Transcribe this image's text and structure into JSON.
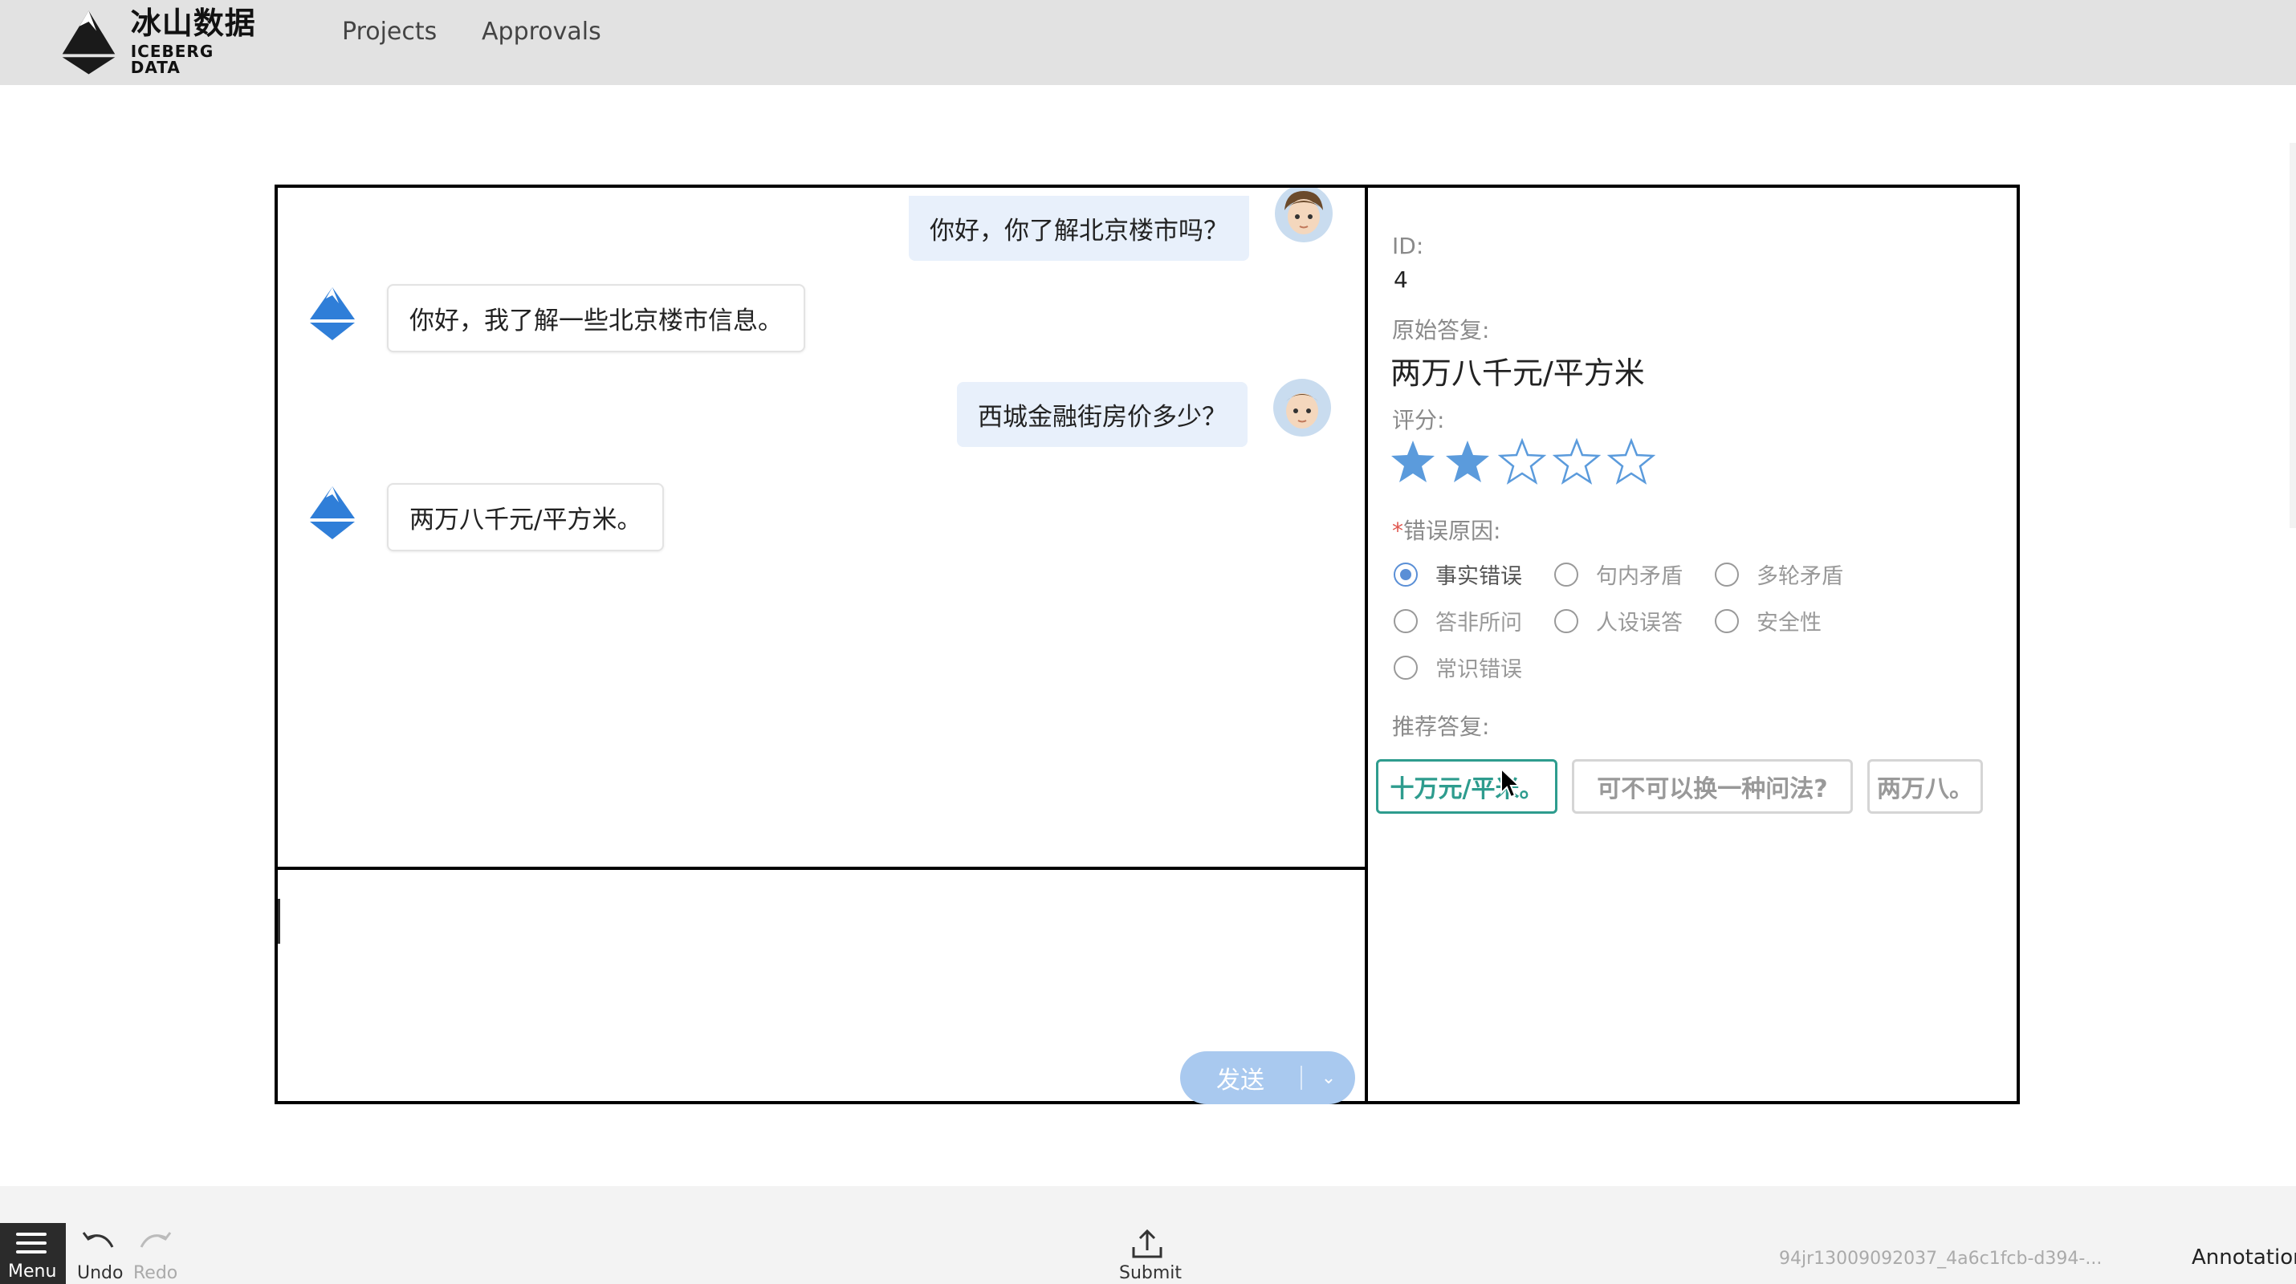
{
  "brand": {
    "name_cn": "冰山数据",
    "name_en": "ICEBERG DATA"
  },
  "nav": {
    "projects": "Projects",
    "approvals": "Approvals"
  },
  "chat": {
    "messages": [
      {
        "role": "user",
        "text": "你好，你了解北京楼市吗？"
      },
      {
        "role": "bot",
        "text": "你好，我了解一些北京楼市信息。"
      },
      {
        "role": "user",
        "text": "西城金融街房价多少？"
      },
      {
        "role": "bot",
        "text": "两万八千元/平方米。"
      }
    ],
    "send_label": "发送",
    "send_arrow": "⌄"
  },
  "side": {
    "id_label": "ID:",
    "id_value": "4",
    "original_label": "原始答复:",
    "original_value": "两万八千元/平方米",
    "rating_label": "评分:",
    "rating": 2,
    "rating_max": 5,
    "error_required": "*",
    "error_label": "错误原因:",
    "error_options": [
      "事实错误",
      "句内矛盾",
      "多轮矛盾",
      "答非所问",
      "人设误答",
      "安全性",
      "常识错误"
    ],
    "error_selected": "事实错误",
    "suggest_label": "推荐答复:",
    "suggestions": [
      "十万元/平米。",
      "可不可以换一种问法?",
      "两万八。"
    ]
  },
  "toolbar": {
    "menu": "Menu",
    "undo": "Undo",
    "redo": "Redo",
    "submit": "Submit",
    "hash": "94jr13009092037_4a6c1fcb-d394-...",
    "annotation": "Annotation"
  },
  "colors": {
    "accent": "#5a8fd6",
    "star": "#5b9bdc",
    "teal": "#2e9c8e",
    "send": "#a9c9ef"
  }
}
